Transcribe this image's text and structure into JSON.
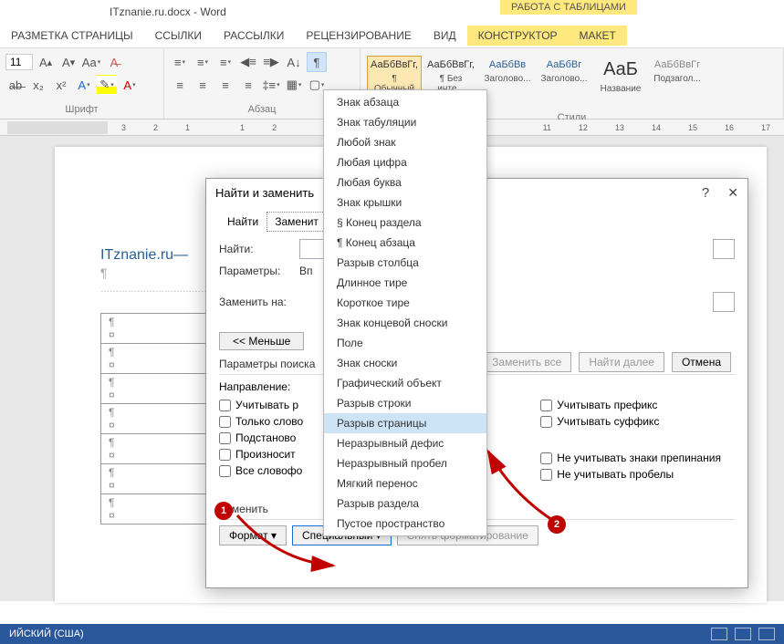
{
  "window_title": "ITznanie.ru.docx - Word",
  "table_tools_header": "РАБОТА С ТАБЛИЦАМИ",
  "ribbon_tabs": [
    "РАЗМЕТКА СТРАНИЦЫ",
    "ССЫЛКИ",
    "РАССЫЛКИ",
    "РЕЦЕНЗИРОВАНИЕ",
    "ВИД",
    "КОНСТРУКТОР",
    "МАКЕТ"
  ],
  "font_size": "11",
  "group_labels": {
    "font": "Шрифт",
    "paragraph": "Абзац",
    "styles": "Стили"
  },
  "styles": [
    {
      "preview": "АаБбВвГг,",
      "name": "¶ Обычный"
    },
    {
      "preview": "АаБбВвГг,",
      "name": "¶ Без инте..."
    },
    {
      "preview": "АаБбВв",
      "name": "Заголово..."
    },
    {
      "preview": "АаБбВг",
      "name": "Заголово..."
    },
    {
      "preview": "АаБ",
      "name": "Название"
    },
    {
      "preview": "АаБбВвГг",
      "name": "Подзагол..."
    }
  ],
  "ruler_nums": [
    "3",
    "2",
    "1",
    "1",
    "2",
    "11",
    "12",
    "13",
    "14",
    "15",
    "16",
    "17"
  ],
  "doc_text": "ITznanie.ru—",
  "dialog": {
    "title": "Найти и заменить",
    "tab_find": "Найти",
    "tab_replace": "Заменит",
    "find_label": "Найти:",
    "params_label": "Параметры:",
    "params_value": "Вп",
    "replace_label": "Заменить на:",
    "less_btn": "<< Меньше",
    "search_params_title": "Параметры поиска",
    "direction_label": "Направление:",
    "check_left": [
      "Учитывать р",
      "Только слово",
      "Подстаново",
      "Произносит",
      "Все словофо"
    ],
    "check_right_top": [
      "Учитывать префикс",
      "Учитывать суффикс"
    ],
    "check_right_bottom": [
      "Не учитывать знаки препинания",
      "Не учитывать пробелы"
    ],
    "replace_title": "Заменить",
    "btn_format": "Формат ▾",
    "btn_special": "Специальный ▾",
    "btn_clear_fmt": "Снять форматирование",
    "btn_replace_all": "Заменить все",
    "btn_find_next": "Найти далее",
    "btn_cancel": "Отмена"
  },
  "special_menu": [
    "Знак абзаца",
    "Знак табуляции",
    "Любой знак",
    "Любая цифра",
    "Любая буква",
    "Знак крышки",
    "§ Конец раздела",
    "¶ Конец абзаца",
    "Разрыв столбца",
    "Длинное тире",
    "Короткое тире",
    "Знак концевой сноски",
    "Поле",
    "Знак сноски",
    "Графический объект",
    "Разрыв строки",
    "Разрыв страницы",
    "Неразрывный дефис",
    "Неразрывный пробел",
    "Мягкий перенос",
    "Разрыв раздела",
    "Пустое пространство"
  ],
  "annotations": {
    "1": "1",
    "2": "2"
  },
  "status_lang": "ИЙСКИЙ (США)"
}
